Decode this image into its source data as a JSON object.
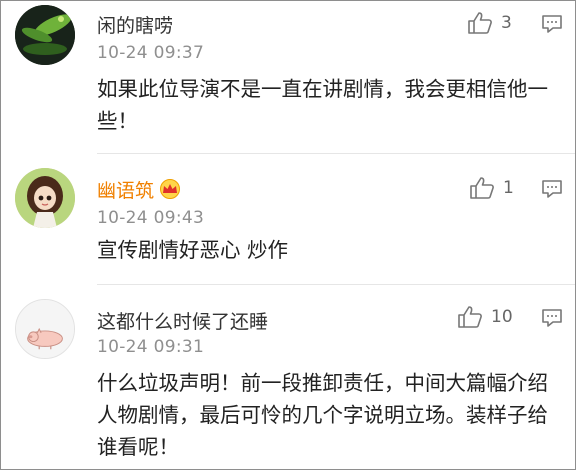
{
  "comments": [
    {
      "username": "闲的瞎唠",
      "time": "10-24 09:37",
      "likes": "3",
      "text": "如果此位导演不是一直在讲剧情，我会更相信他一些！",
      "avatar_icon": "green-plant-avatar",
      "vip": false
    },
    {
      "username": "幽语筑",
      "time": "10-24 09:43",
      "likes": "1",
      "text": "宣传剧情好恶心 炒作",
      "avatar_icon": "doll-girl-avatar",
      "vip": true,
      "badge_icon": "crown-icon"
    },
    {
      "username": "这都什么时候了还睡",
      "time": "10-24 09:31",
      "likes": "10",
      "text": "什么垃圾声明！前一段推卸责任，中间大篇幅介绍人物剧情，最后可怜的几个字说明立场。装样子给谁看呢！",
      "avatar_icon": "pig-avatar",
      "vip": false
    }
  ],
  "colors": {
    "vip_name": "#f08000",
    "username": "#333333",
    "time": "#8f8f8f",
    "icon": "#777777"
  }
}
